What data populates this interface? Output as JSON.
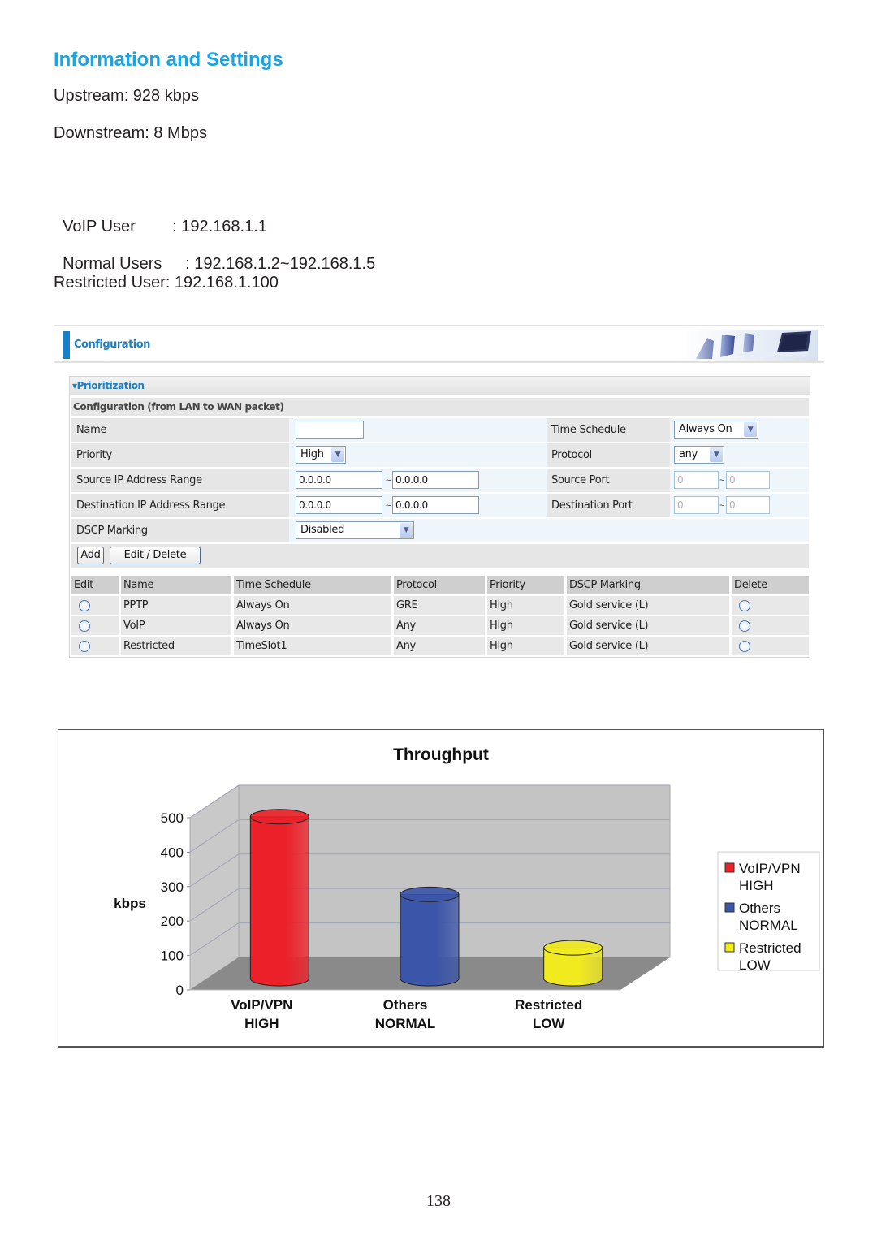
{
  "heading": "Information and Settings",
  "info": {
    "upstream": "Upstream: 928 kbps",
    "downstream": "Downstream: 8 Mbps",
    "voip_user_label": "VoIP User",
    "voip_user_value": ": 192.168.1.1",
    "normal_users_label": "Normal Users",
    "normal_users_value": ": 192.168.1.2~192.168.1.5",
    "restricted_user": "Restricted User: 192.168.1.100"
  },
  "config": {
    "title": "Configuration",
    "section": "▾Prioritization",
    "subsection": "Configuration (from LAN to WAN packet)",
    "fields": {
      "name_label": "Name",
      "name_value": "",
      "priority_label": "Priority",
      "priority_value": "High",
      "src_ip_label": "Source IP Address Range",
      "src_ip_from": "0.0.0.0",
      "src_ip_to": "0.0.0.0",
      "dst_ip_label": "Destination IP Address Range",
      "dst_ip_from": "0.0.0.0",
      "dst_ip_to": "0.0.0.0",
      "dscp_label": "DSCP Marking",
      "dscp_value": "Disabled",
      "time_schedule_label": "Time Schedule",
      "time_schedule_value": "Always On",
      "protocol_label": "Protocol",
      "protocol_value": "any",
      "src_port_label": "Source Port",
      "src_port_from": "0",
      "src_port_to": "0",
      "dst_port_label": "Destination Port",
      "dst_port_from": "0",
      "dst_port_to": "0",
      "range_sep": "~"
    },
    "buttons": {
      "add": "Add",
      "edit_delete": "Edit / Delete"
    },
    "table": {
      "headers": [
        "Edit",
        "Name",
        "Time Schedule",
        "Protocol",
        "Priority",
        "DSCP Marking",
        "Delete"
      ],
      "rows": [
        {
          "name": "PPTP",
          "schedule": "Always On",
          "protocol": "GRE",
          "priority": "High",
          "dscp": "Gold service (L)"
        },
        {
          "name": "VoIP",
          "schedule": "Always On",
          "protocol": "Any",
          "priority": "High",
          "dscp": "Gold service (L)"
        },
        {
          "name": "Restricted",
          "schedule": "TimeSlot1",
          "protocol": "Any",
          "priority": "High",
          "dscp": "Gold service (L)"
        }
      ]
    },
    "dropdown_icon": "chevron-down-icon"
  },
  "chart_data": {
    "type": "bar",
    "style": "3d-cylinder",
    "title": "Throughput",
    "xlabel": "",
    "ylabel": "kbps",
    "ylim": [
      0,
      500
    ],
    "yticks": [
      0,
      100,
      200,
      300,
      400,
      500
    ],
    "grid": true,
    "categories": [
      [
        "VoIP/VPN",
        "HIGH"
      ],
      [
        "Others",
        "NORMAL"
      ],
      [
        "Restricted",
        "LOW"
      ]
    ],
    "values": [
      500,
      260,
      95
    ],
    "colors": [
      "#ec2028",
      "#3b55a8",
      "#f1ea1f"
    ],
    "legend": {
      "position": "right",
      "entries": [
        [
          "VoIP/VPN",
          "HIGH"
        ],
        [
          "Others",
          "NORMAL"
        ],
        [
          "Restricted",
          "LOW"
        ]
      ]
    }
  },
  "page_number": "138"
}
